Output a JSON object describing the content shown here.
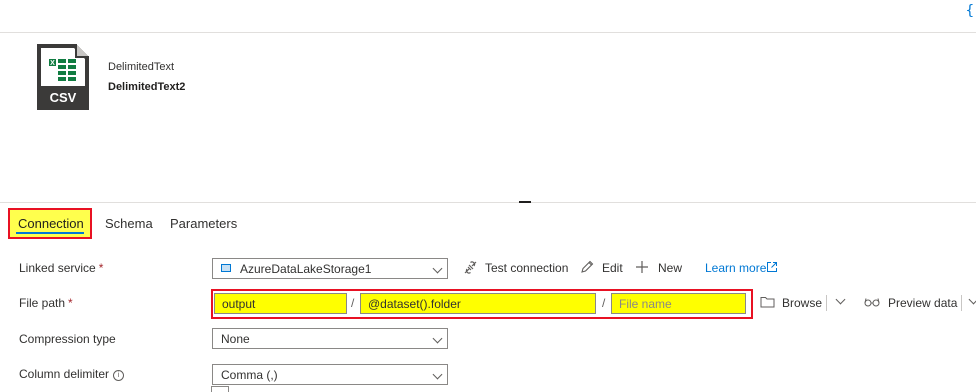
{
  "toolbar": {
    "code_icon": "code-brace-icon",
    "code_glyph": "{"
  },
  "dataset": {
    "icon": "csv-file-icon",
    "icon_text": "CSV",
    "type": "DelimitedText",
    "name": "DelimitedText2"
  },
  "tabs": [
    {
      "label": "Connection",
      "active": true
    },
    {
      "label": "Schema",
      "active": false
    },
    {
      "label": "Parameters",
      "active": false
    }
  ],
  "form": {
    "linked_service": {
      "label": "Linked service",
      "required": "*",
      "value": "AzureDataLakeStorage1",
      "actions": {
        "test_connection": "Test connection",
        "edit": "Edit",
        "new": "New",
        "learn_more": "Learn more"
      }
    },
    "file_path": {
      "label": "File path",
      "required": "*",
      "container": "output",
      "separator": "/",
      "directory": "@dataset().folder",
      "file_placeholder": "File name",
      "browse": "Browse",
      "preview": "Preview data"
    },
    "compression_type": {
      "label": "Compression type",
      "value": "None"
    },
    "column_delimiter": {
      "label": "Column delimiter",
      "info": "i",
      "value": "Comma (,)"
    }
  },
  "colors": {
    "highlight": "#ffff00",
    "annotation_border": "#e81123",
    "accent": "#0078d4",
    "csv_green": "#107c41",
    "icon_dark": "#3b3a39"
  }
}
